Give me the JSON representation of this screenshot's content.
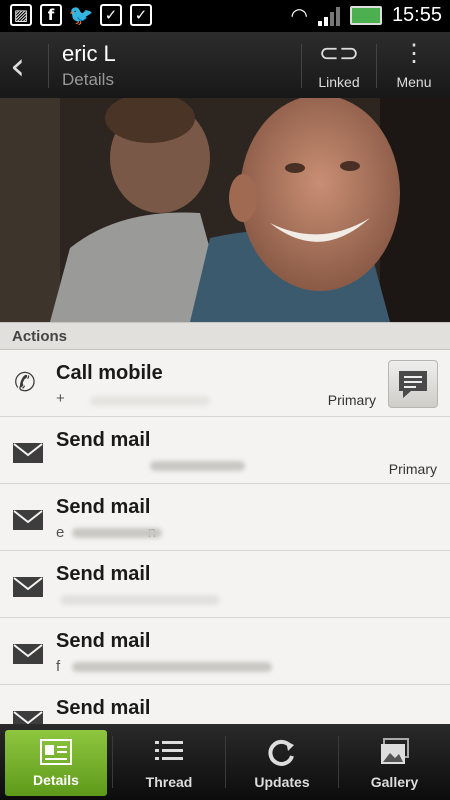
{
  "status_bar": {
    "time": "15:55"
  },
  "title_bar": {
    "title": "eric L",
    "subtitle": "Details",
    "linked_label": "Linked",
    "menu_label": "Menu"
  },
  "section_header": "Actions",
  "actions": [
    {
      "title": "Call mobile",
      "detail": "+",
      "primary": "Primary",
      "icon": "phone-icon"
    },
    {
      "title": "Send mail",
      "detail": "",
      "primary": "Primary",
      "icon": "mail-icon"
    },
    {
      "title": "Send mail",
      "detail": "e                    n",
      "primary": "",
      "icon": "mail-icon"
    },
    {
      "title": "Send mail",
      "detail": "",
      "primary": "",
      "icon": "mail-icon"
    },
    {
      "title": "Send mail",
      "detail": "f",
      "primary": "",
      "icon": "mail-icon"
    },
    {
      "title": "Send mail",
      "detail": "",
      "primary": "",
      "icon": "mail-icon"
    }
  ],
  "bottom_tabs": [
    {
      "label": "Details",
      "active": true
    },
    {
      "label": "Thread",
      "active": false
    },
    {
      "label": "Updates",
      "active": false
    },
    {
      "label": "Gallery",
      "active": false
    }
  ],
  "colors": {
    "accent": "#7cb82f",
    "list_bg": "#f4f3f1",
    "bar_bg": "#1a1a1a"
  }
}
